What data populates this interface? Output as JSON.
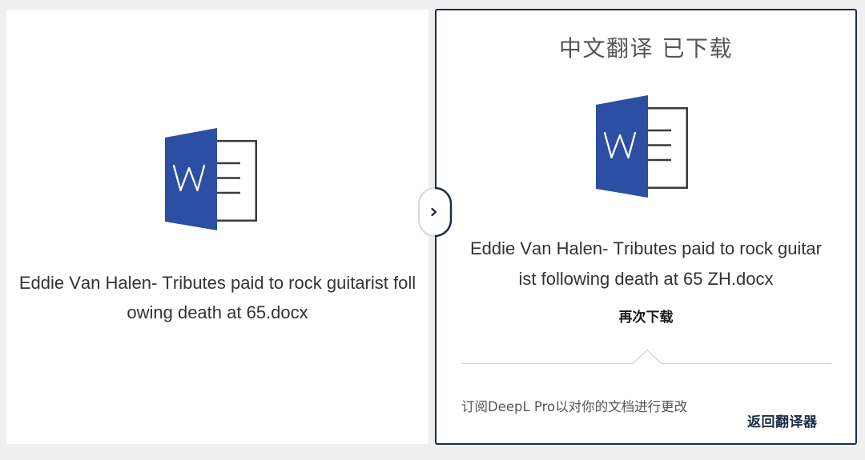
{
  "left_panel": {
    "icon": "word-document-icon",
    "icon_letter": "W",
    "filename": "Eddie Van Halen- Tributes paid to rock guitarist following death at 65.docx"
  },
  "toggle": {
    "icon": "chevron-right-icon"
  },
  "right_panel": {
    "title": "中文翻译 已下载",
    "icon": "word-document-icon",
    "icon_letter": "W",
    "filename": "Eddie Van Halen- Tributes paid to rock guitarist following death at 65 ZH.docx",
    "download_again_label": "再次下载",
    "subscribe_text": "订阅DeepL Pro以对你的文档进行更改",
    "back_to_translator_label": "返回翻译器"
  },
  "colors": {
    "page_background": "#efefef",
    "word_blue": "#2c4fa3",
    "accent_navy": "#1d2c43",
    "icon_outline": "#3a3a3a"
  }
}
